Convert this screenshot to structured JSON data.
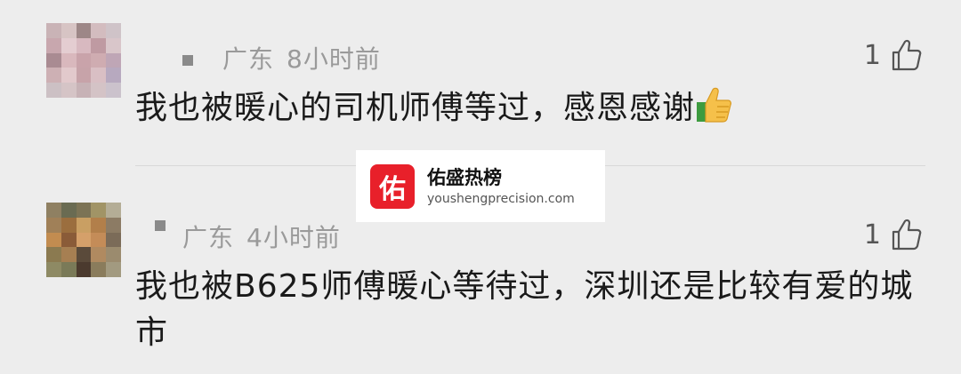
{
  "comments": [
    {
      "location": "广东",
      "time": "8小时前",
      "likes": "1",
      "text": "我也被暖心的司机师傅等过，感恩感谢",
      "emoji": "thumbs-up"
    },
    {
      "location": "广东",
      "time": "4小时前",
      "likes": "1",
      "text": "我也被B625师傅暖心等待过，深圳还是比较有爱的城市"
    }
  ],
  "watermark": {
    "logo_char": "佑",
    "title": "佑盛热榜",
    "url": "youshengprecision.com"
  },
  "colors": {
    "background": "#ededed",
    "meta": "#9a9a9a",
    "text": "#1a1a1a",
    "watermark_red": "#e8202a"
  }
}
